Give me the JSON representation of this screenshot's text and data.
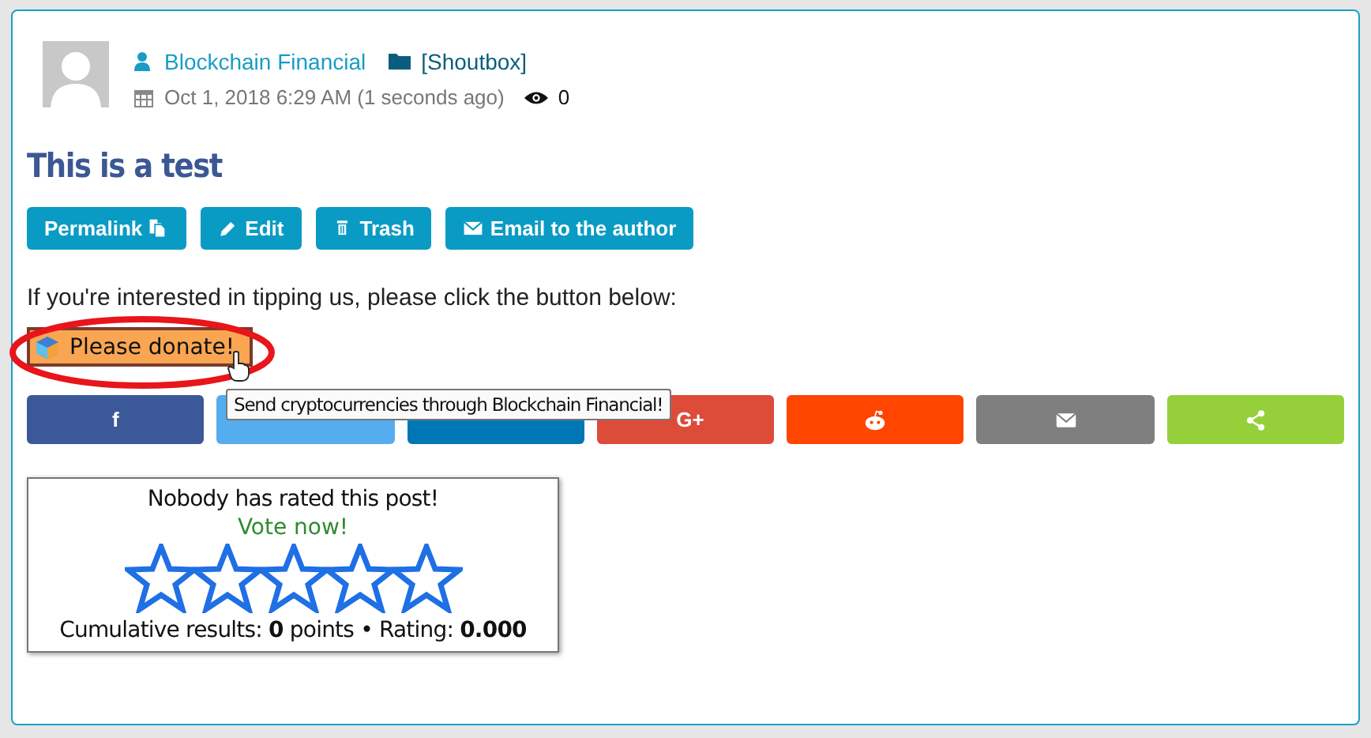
{
  "post": {
    "author": "Blockchain Financial",
    "category": "[Shoutbox]",
    "date": "Oct 1, 2018 6:29 AM (1 seconds ago)",
    "views": "0",
    "title": "This is a test"
  },
  "actions": [
    {
      "label": "Permalink",
      "kind": "permalink"
    },
    {
      "label": "Edit",
      "kind": "edit"
    },
    {
      "label": "Trash",
      "kind": "trash"
    },
    {
      "label": "Email to the author",
      "kind": "email"
    }
  ],
  "tip_text": "If you're interested in tipping us, please click the button below:",
  "donate": {
    "label": "Please donate!",
    "tooltip": "Send cryptocurrencies through Blockchain Financial!"
  },
  "share": [
    {
      "kind": "facebook",
      "glyph": "f",
      "color": "#3b5998"
    },
    {
      "kind": "twitter",
      "color": "#55acee"
    },
    {
      "kind": "linkedin",
      "color": "#0077b5"
    },
    {
      "kind": "googleplus",
      "glyph": "G+",
      "color": "#dd4b39"
    },
    {
      "kind": "reddit",
      "color": "#ff4500"
    },
    {
      "kind": "email",
      "color": "#7f7f7f"
    },
    {
      "kind": "share",
      "color": "#95d03a"
    }
  ],
  "rating": {
    "heading": "Nobody has rated this post!",
    "vote": "Vote now!",
    "stars": 0,
    "results": "Cumulative results: **0** points • Rating: **0.000**"
  }
}
